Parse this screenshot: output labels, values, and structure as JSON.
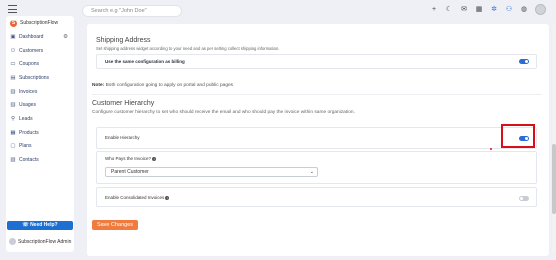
{
  "topbar": {
    "search_placeholder": "Search e.g \"John Doe\"",
    "icons": [
      "plus-icon",
      "moon-icon",
      "mail-icon",
      "calendar-icon",
      "gear-icon",
      "users-icon",
      "globe-icon",
      "user-avatar"
    ]
  },
  "sidebar": {
    "brand": "SubscriptionFlow",
    "items": [
      {
        "label": "Dashboard",
        "icon": "dashboard-icon"
      },
      {
        "label": "Customers",
        "icon": "users-icon"
      },
      {
        "label": "Coupons",
        "icon": "coupon-icon"
      },
      {
        "label": "Subscriptions",
        "icon": "subscriptions-icon"
      },
      {
        "label": "Invoices",
        "icon": "invoice-icon"
      },
      {
        "label": "Usages",
        "icon": "usages-icon"
      },
      {
        "label": "Leads",
        "icon": "leads-icon"
      },
      {
        "label": "Products",
        "icon": "products-icon"
      },
      {
        "label": "Plans",
        "icon": "plans-icon"
      },
      {
        "label": "Contacts",
        "icon": "contacts-icon"
      }
    ],
    "help_label": "Need Help?",
    "admin_label": "SubscriptionFlow Admin"
  },
  "shipping": {
    "title": "Shipping Address",
    "description": "Set shipping address widget according to your need and as per setting collect shipping information.",
    "same_as_billing_label": "Use the same configuration as billing",
    "same_as_billing_on": true
  },
  "note": {
    "prefix": "Note:",
    "text": "Both configuration going to apply on portal and public pages"
  },
  "hierarchy": {
    "title": "Customer Hierarchy",
    "description": "Configure customer hierarchy to set who should receive the email and who should pay the invoice within same organization.",
    "enable_label": "Enable Hierarchy",
    "enable_on": true,
    "who_pays_label": "Who Pays the Invoice?",
    "who_pays_value": "Parent Customer",
    "consolidated_label": "Enable Consolidated Invoices",
    "consolidated_on": false
  },
  "save_label": "Save Changes",
  "colors": {
    "accent": "#2d6bd6",
    "save": "#f07b3f",
    "highlight": "#d6101a"
  }
}
